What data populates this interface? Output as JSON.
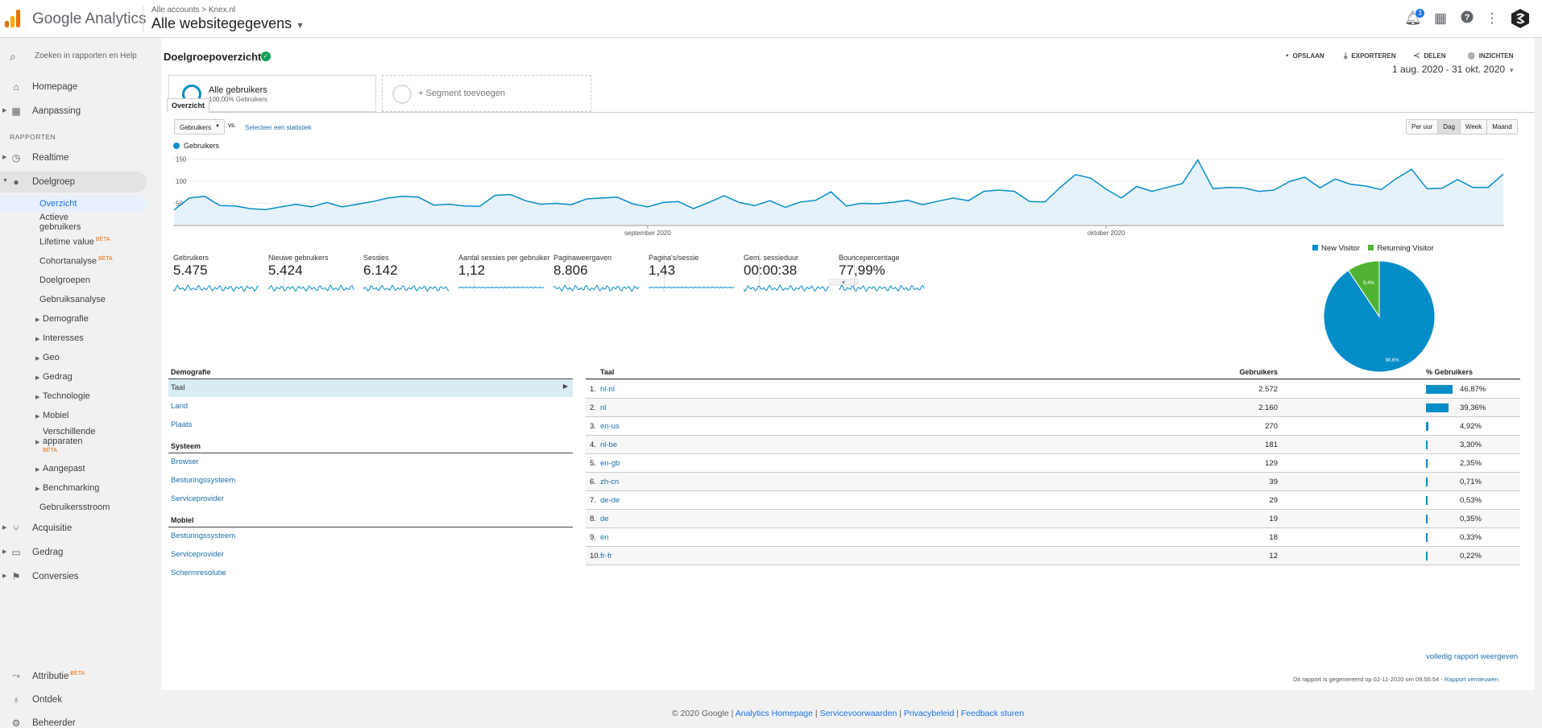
{
  "header": {
    "app_name": "Google Analytics",
    "account_path": "Alle accounts  >  Knex.nl",
    "view_name": "Alle websitegegevens",
    "notification_count": "3"
  },
  "sidebar": {
    "search_placeholder": "Zoeken in rapporten en Help",
    "homepage": "Homepage",
    "customization": "Aanpassing",
    "reports_label": "RAPPORTEN",
    "realtime": "Realtime",
    "audience": "Doelgroep",
    "audience_items": {
      "overview": "Overzicht",
      "active_users": "Actieve gebruikers",
      "lifetime_value": "Lifetime value",
      "cohort": "Cohortanalyse",
      "audiences": "Doelgroepen",
      "user_explorer": "Gebruiksanalyse",
      "demographics": "Demografie",
      "interests": "Interesses",
      "geo": "Geo",
      "behavior": "Gedrag",
      "technology": "Technologie",
      "mobile": "Mobiel",
      "cross_device": "Verschillende apparaten",
      "custom": "Aangepast",
      "benchmarking": "Benchmarking",
      "users_flow": "Gebruikersstroom"
    },
    "beta_label": "BÈTA",
    "acquisition": "Acquisitie",
    "behavior": "Gedrag",
    "conversions": "Conversies",
    "attribution": "Attributie",
    "discover": "Ontdek",
    "admin": "Beheerder"
  },
  "page": {
    "title": "Doelgroepoverzicht",
    "toolbar": {
      "save": "OPSLAAN",
      "export": "EXPORTEREN",
      "share": "DELEN",
      "insights": "INZICHTEN"
    },
    "segment_name": "Alle gebruikers",
    "segment_sub": "100,00% Gebruikers",
    "add_segment": "+ Segment toevoegen",
    "date_range": "1 aug. 2020 - 31 okt. 2020",
    "tab_overview": "Overzicht",
    "metric_select": "Gebruikers",
    "vs": "vs.",
    "select_metric": "Selecteer een statistiek",
    "granularity": [
      "Per uur",
      "Dag",
      "Week",
      "Maand"
    ],
    "granularity_selected": "Dag"
  },
  "chart_data": {
    "type": "area",
    "series": [
      {
        "name": "Gebruikers",
        "values": [
          35,
          62,
          66,
          45,
          44,
          38,
          36,
          42,
          48,
          42,
          52,
          42,
          48,
          54,
          62,
          66,
          64,
          46,
          48,
          44,
          43,
          68,
          70,
          56,
          48,
          50,
          47,
          60,
          62,
          64,
          49,
          42,
          52,
          54,
          38,
          52,
          67,
          52,
          45,
          56,
          41,
          53,
          57,
          76,
          44,
          50,
          49,
          52,
          57,
          47,
          55,
          62,
          56,
          77,
          80,
          77,
          54,
          53,
          86,
          115,
          107,
          82,
          62,
          88,
          77,
          86,
          95,
          148,
          83,
          86,
          85,
          77,
          80,
          99,
          109,
          85,
          105,
          93,
          89,
          81,
          106,
          127,
          83,
          84,
          104,
          86,
          86,
          116
        ]
      }
    ],
    "y_ticks": [
      "150",
      "100",
      "50"
    ],
    "x_labels": [
      "september 2020",
      "oktober 2020"
    ],
    "ylim": [
      0,
      160
    ],
    "color": "#058dc7"
  },
  "scorecards": [
    {
      "label": "Gebruikers",
      "value": "5.475"
    },
    {
      "label": "Nieuwe gebruikers",
      "value": "5.424"
    },
    {
      "label": "Sessies",
      "value": "6.142"
    },
    {
      "label": "Aantal sessies per gebruiker",
      "value": "1,12"
    },
    {
      "label": "Paginaweergaven",
      "value": "8.806"
    },
    {
      "label": "Pagina's/sessie",
      "value": "1,43"
    },
    {
      "label": "Gem. sessieduur",
      "value": "00:00:38"
    },
    {
      "label": "Bouncepercentage",
      "value": "77,99%"
    }
  ],
  "pie": {
    "legend": [
      "New Visitor",
      "Returning Visitor"
    ],
    "colors": [
      "#058dc7",
      "#50b432"
    ],
    "values": [
      90.6,
      9.4
    ],
    "labels": [
      "90,6%",
      "9,4%"
    ]
  },
  "left_table": {
    "demo_header": "Demografie",
    "demo_items": [
      "Taal",
      "Land",
      "Plaats"
    ],
    "system_header": "Systeem",
    "system_items": [
      "Browser",
      "Besturingssysteem",
      "Serviceprovider"
    ],
    "mobile_header": "Mobiel",
    "mobile_items": [
      "Besturingssysteem",
      "Serviceprovider",
      "Schermresolutie"
    ]
  },
  "right_table": {
    "col_lang": "Taal",
    "col_users": "Gebruikers",
    "col_pct": "% Gebruikers",
    "rows": [
      {
        "idx": "1.",
        "code": "nl-nl",
        "users": "2.572",
        "pct": "46,87%",
        "frac": 0.4687
      },
      {
        "idx": "2.",
        "code": "nl",
        "users": "2.160",
        "pct": "39,36%",
        "frac": 0.3936
      },
      {
        "idx": "3.",
        "code": "en-us",
        "users": "270",
        "pct": "4,92%",
        "frac": 0.0492
      },
      {
        "idx": "4.",
        "code": "nl-be",
        "users": "181",
        "pct": "3,30%",
        "frac": 0.033
      },
      {
        "idx": "5.",
        "code": "en-gb",
        "users": "129",
        "pct": "2,35%",
        "frac": 0.0235
      },
      {
        "idx": "6.",
        "code": "zh-cn",
        "users": "39",
        "pct": "0,71%",
        "frac": 0.0071
      },
      {
        "idx": "7.",
        "code": "de-de",
        "users": "29",
        "pct": "0,53%",
        "frac": 0.0053
      },
      {
        "idx": "8.",
        "code": "de",
        "users": "19",
        "pct": "0,35%",
        "frac": 0.0035
      },
      {
        "idx": "9.",
        "code": "en",
        "users": "18",
        "pct": "0,33%",
        "frac": 0.0033
      },
      {
        "idx": "10.",
        "code": "fr-fr",
        "users": "12",
        "pct": "0,22%",
        "frac": 0.0022
      }
    ],
    "full_report": "volledig rapport weergeven"
  },
  "generated": {
    "text": "Dit rapport is gegenereerd op 02-11-2020 om 09:55:54 - ",
    "link": "Rapport vernieuwen"
  },
  "footer": {
    "copyright": "© 2020 Google | ",
    "links": [
      "Analytics Homepage",
      "Servicevoorwaarden",
      "Privacybeleid",
      "Feedback sturen"
    ]
  }
}
